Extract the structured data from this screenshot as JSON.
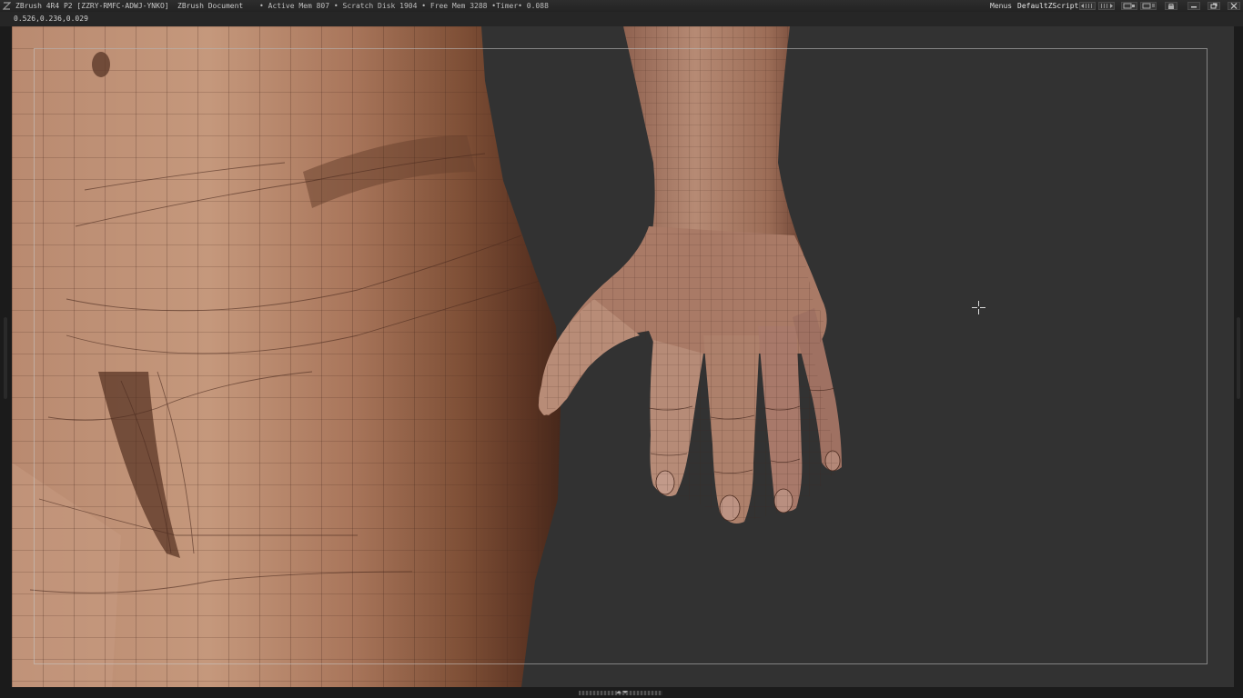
{
  "titlebar": {
    "app_title": "ZBrush 4R4 P2 [ZZRY-RMFC-ADWJ-YNKO]",
    "doc_title": "ZBrush Document",
    "mem_info": "• Active Mem 807 • Scratch Disk 1904 • Free Mem 3288 •Timer• 0.088",
    "menus_label": "Menus",
    "script_label": "DefaultZScript"
  },
  "coords": "0.526,0.236,0.029",
  "viewport": {
    "background_color": "#323232",
    "skin_color": "#b07d63",
    "wire_color": "#4a2a1e",
    "cursor": "crosshair-cursor"
  }
}
